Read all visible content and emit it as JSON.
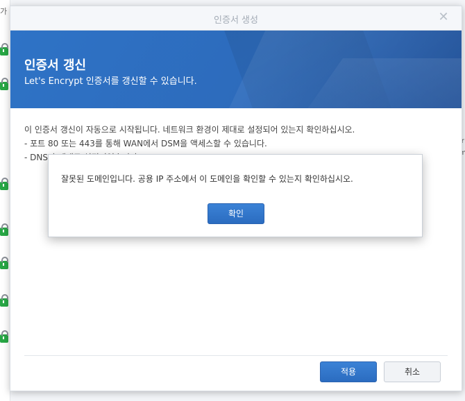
{
  "background": {
    "left_top_text": "가",
    "right_text_1": "ir",
    "right_text_2": "m"
  },
  "dialog": {
    "title": "인증서 생성",
    "close_icon": "close-icon",
    "hero_title": "인증서 갱신",
    "hero_subtitle": "Let's Encrypt 인증서를 갱신할 수 있습니다.",
    "content_lines": [
      "이 인증서 갱신이 자동으로 시작됩니다. 네트워크 환경이 제대로 설정되어 있는지 확인하십시오.",
      "- 포트 80 또는 443를 통해 WAN에서 DSM을 액세스할 수 있습니다.",
      "- DNS가 제대로 설정되었습니다."
    ],
    "apply_label": "적용",
    "cancel_label": "취소"
  },
  "alert": {
    "message": "잘못된 도메인입니다. 공용 IP 주소에서 이 도메인을 확인할 수 있는지 확인하십시오.",
    "ok_label": "확인"
  },
  "colors": {
    "accent": "#2e73c6",
    "success": "#28a745"
  }
}
